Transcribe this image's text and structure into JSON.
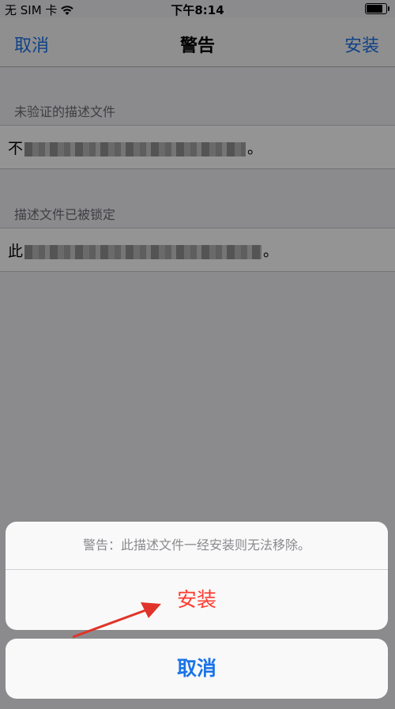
{
  "status_bar": {
    "carrier": "无 SIM 卡",
    "wifi_icon": "wifi-icon",
    "time": "下午8:14",
    "battery_icon": "battery-icon"
  },
  "nav_bar": {
    "left_label": "取消",
    "title": "警告",
    "right_label": "安装",
    "accent_color": "#1a73e8"
  },
  "sections": [
    {
      "header": "未验证的描述文件",
      "cell_start": "不",
      "cell_end": "。"
    },
    {
      "header": "描述文件已被锁定",
      "cell_start": "此",
      "cell_end": "。"
    }
  ],
  "action_sheet": {
    "message": "警告：此描述文件一经安装则无法移除。",
    "install_label": "安装",
    "cancel_label": "取消",
    "destructive_color": "#ff3b30"
  },
  "annotation": {
    "arrow_color": "#e0342a",
    "arrow_icon": "red-arrow-icon"
  }
}
